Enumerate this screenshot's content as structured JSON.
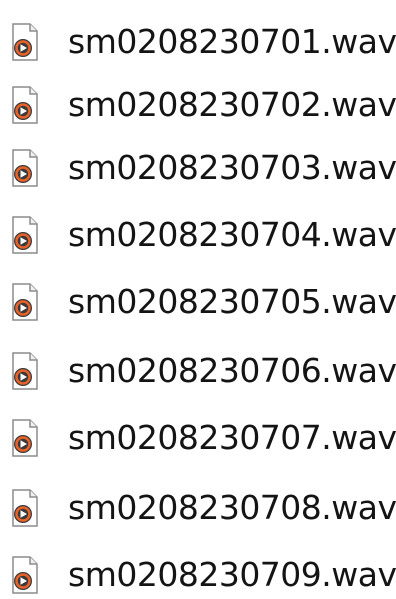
{
  "files": [
    {
      "name": "sm0208230701.wav",
      "icon": "wav-audio-file-icon"
    },
    {
      "name": "sm0208230702.wav",
      "icon": "wav-audio-file-icon"
    },
    {
      "name": "sm0208230703.wav",
      "icon": "wav-audio-file-icon"
    },
    {
      "name": "sm0208230704.wav",
      "icon": "wav-audio-file-icon"
    },
    {
      "name": "sm0208230705.wav",
      "icon": "wav-audio-file-icon"
    },
    {
      "name": "sm0208230706.wav",
      "icon": "wav-audio-file-icon"
    },
    {
      "name": "sm0208230707.wav",
      "icon": "wav-audio-file-icon"
    },
    {
      "name": "sm0208230708.wav",
      "icon": "wav-audio-file-icon"
    },
    {
      "name": "sm0208230709.wav",
      "icon": "wav-audio-file-icon"
    }
  ],
  "colors": {
    "icon_badge": "#3a3a3a",
    "icon_ring": "#e8622a",
    "icon_page": "#ffffff",
    "icon_border": "#8c8c8c",
    "text": "#141414"
  }
}
